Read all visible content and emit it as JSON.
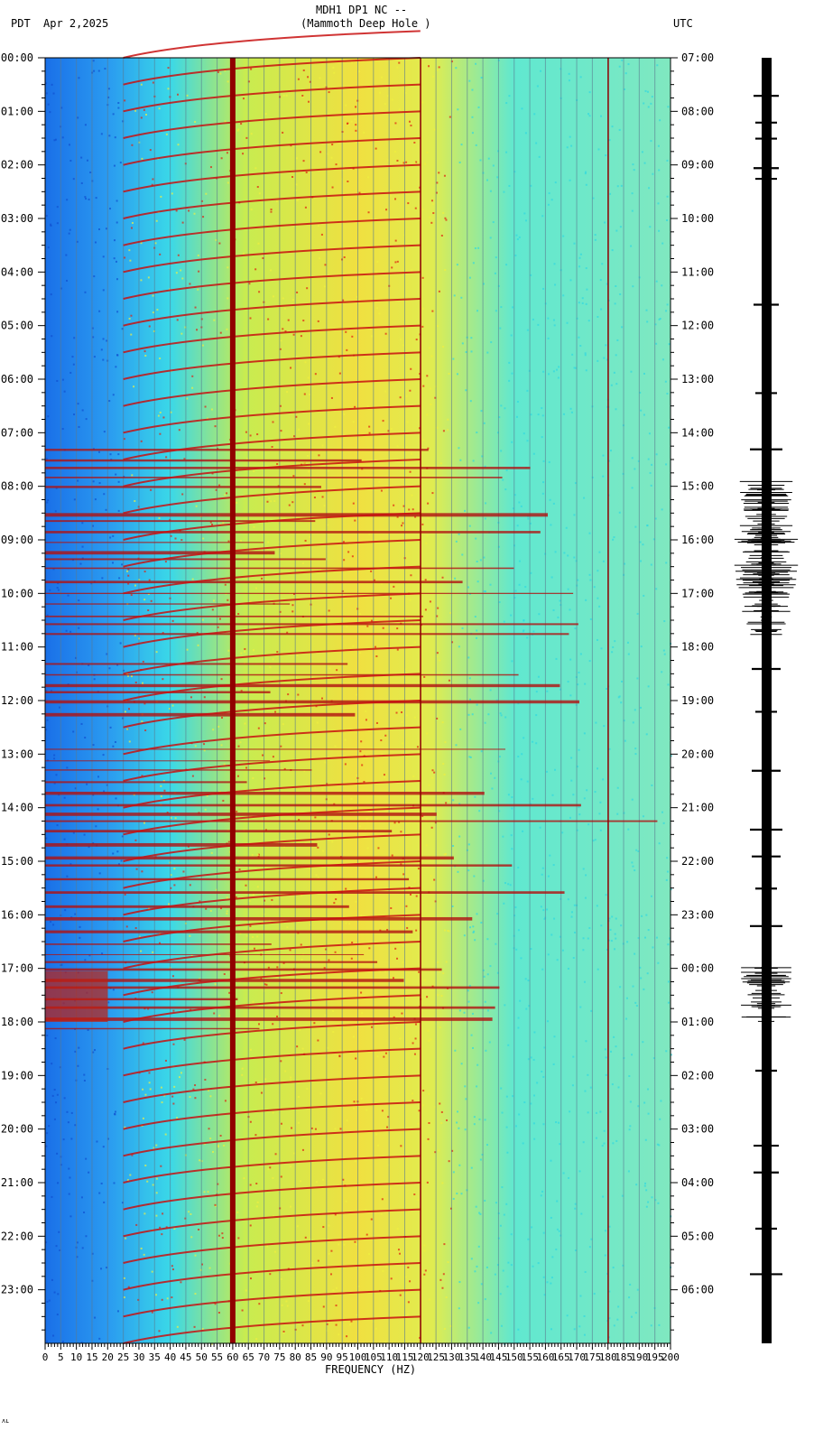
{
  "header": {
    "title": "MDH1 DP1 NC --",
    "subtitle": "(Mammoth Deep Hole )",
    "left_timezone": "PDT",
    "date": "Apr 2,2025",
    "right_timezone": "UTC"
  },
  "footer_mark": "ʌʟ",
  "chart_data": {
    "type": "heatmap",
    "title": "MDH1 DP1 NC --",
    "subtitle": "(Mammoth Deep Hole )",
    "xlabel": "FREQUENCY (HZ)",
    "xlim": [
      0,
      200
    ],
    "x_ticks": [
      0,
      5,
      10,
      15,
      20,
      25,
      30,
      35,
      40,
      45,
      50,
      55,
      60,
      65,
      70,
      75,
      80,
      85,
      90,
      95,
      100,
      105,
      110,
      115,
      120,
      125,
      130,
      135,
      140,
      145,
      150,
      155,
      160,
      165,
      170,
      175,
      180,
      185,
      190,
      195,
      200
    ],
    "ylim_hours": [
      0,
      24
    ],
    "y_ticks_left": [
      "00:00",
      "01:00",
      "02:00",
      "03:00",
      "04:00",
      "05:00",
      "06:00",
      "07:00",
      "08:00",
      "09:00",
      "10:00",
      "11:00",
      "12:00",
      "13:00",
      "14:00",
      "15:00",
      "16:00",
      "17:00",
      "18:00",
      "19:00",
      "20:00",
      "21:00",
      "22:00",
      "23:00"
    ],
    "y_ticks_right": [
      "07:00",
      "08:00",
      "09:00",
      "10:00",
      "11:00",
      "12:00",
      "13:00",
      "14:00",
      "15:00",
      "16:00",
      "17:00",
      "18:00",
      "19:00",
      "20:00",
      "21:00",
      "22:00",
      "23:00",
      "00:00",
      "01:00",
      "02:00",
      "03:00",
      "04:00",
      "05:00",
      "06:00"
    ],
    "colormap": [
      "#1060e0",
      "#20a0f0",
      "#30e0e0",
      "#e8f040",
      "#f0a020",
      "#c01010",
      "#900000"
    ],
    "persistent_lines_hz": [
      60,
      120,
      180
    ],
    "event_periods_pdt_hours": [
      [
        7.3,
        8.1
      ],
      [
        8.5,
        10.8
      ],
      [
        11.3,
        12.3
      ],
      [
        12.9,
        16.9
      ],
      [
        17.0,
        18.2
      ]
    ],
    "seismogram_bursts": [
      {
        "hour": 0.7,
        "amp": 0.35
      },
      {
        "hour": 1.2,
        "amp": 0.3
      },
      {
        "hour": 1.5,
        "amp": 0.3
      },
      {
        "hour": 2.05,
        "amp": 0.35
      },
      {
        "hour": 2.25,
        "amp": 0.3
      },
      {
        "hour": 4.6,
        "amp": 0.35
      },
      {
        "hour": 6.25,
        "amp": 0.3
      },
      {
        "hour": 7.3,
        "amp": 0.45
      },
      {
        "hour": 8.5,
        "amp": 0.8
      },
      {
        "hour": 9.3,
        "amp": 0.9
      },
      {
        "hour": 10.2,
        "amp": 0.7
      },
      {
        "hour": 11.4,
        "amp": 0.4
      },
      {
        "hour": 12.2,
        "amp": 0.3
      },
      {
        "hour": 13.3,
        "amp": 0.4
      },
      {
        "hour": 14.4,
        "amp": 0.45
      },
      {
        "hour": 14.9,
        "amp": 0.4
      },
      {
        "hour": 15.5,
        "amp": 0.3
      },
      {
        "hour": 16.2,
        "amp": 0.45
      },
      {
        "hour": 17.5,
        "amp": 0.7
      },
      {
        "hour": 18.9,
        "amp": 0.3
      },
      {
        "hour": 20.3,
        "amp": 0.35
      },
      {
        "hour": 20.8,
        "amp": 0.35
      },
      {
        "hour": 21.85,
        "amp": 0.3
      },
      {
        "hour": 22.7,
        "amp": 0.45
      }
    ]
  }
}
